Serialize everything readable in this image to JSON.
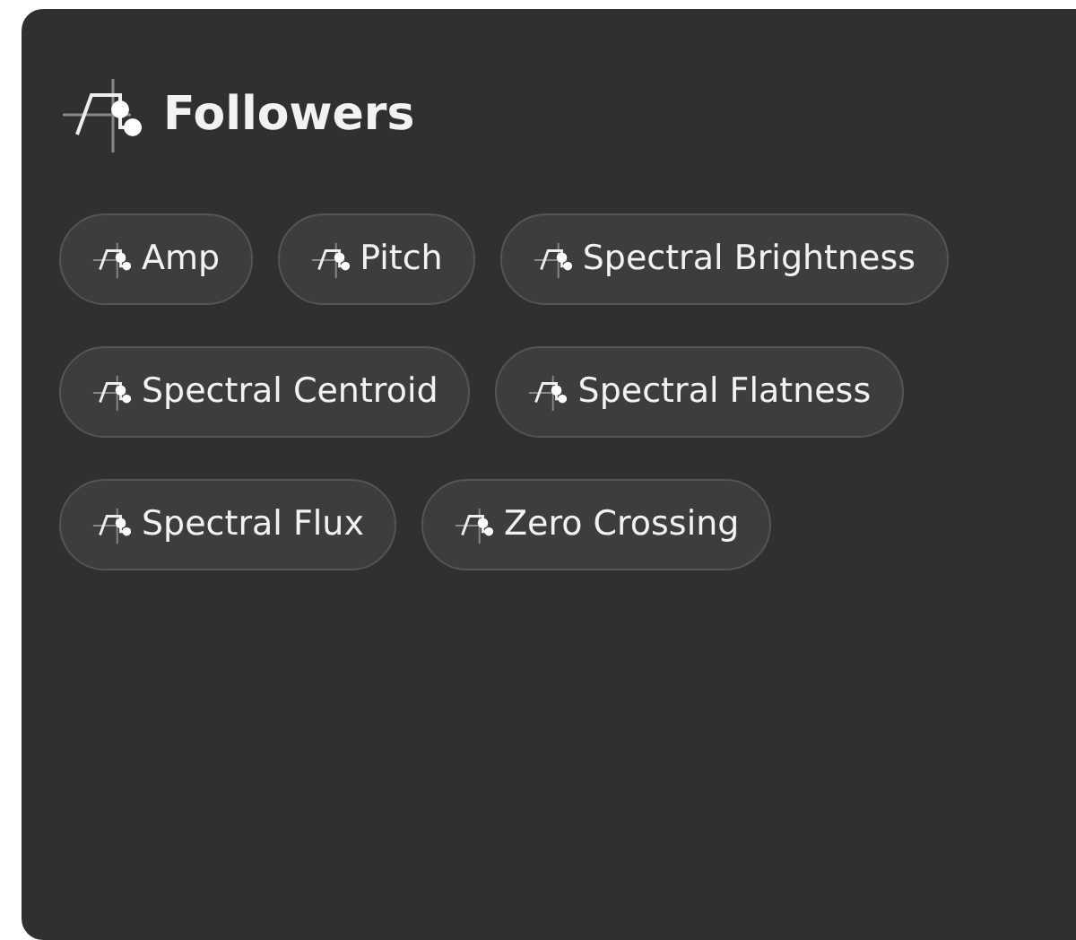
{
  "panel": {
    "title": "Followers"
  },
  "chips": [
    {
      "label": "Amp"
    },
    {
      "label": "Pitch"
    },
    {
      "label": "Spectral Brightness"
    },
    {
      "label": "Spectral Centroid"
    },
    {
      "label": "Spectral Flatness"
    },
    {
      "label": "Spectral Flux"
    },
    {
      "label": "Zero Crossing"
    }
  ]
}
